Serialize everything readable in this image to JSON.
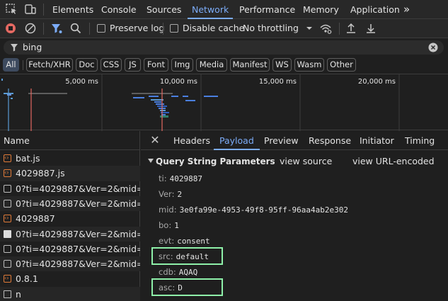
{
  "top_tabs": [
    {
      "label": "Elements"
    },
    {
      "label": "Console"
    },
    {
      "label": "Sources"
    },
    {
      "label": "Network"
    },
    {
      "label": "Performance"
    },
    {
      "label": "Memory"
    },
    {
      "label": "Application"
    }
  ],
  "more_tabs": "»",
  "toolbar": {
    "preserve_log": "Preserve log",
    "disable_cache": "Disable cache",
    "throttling": "No throttling"
  },
  "filter": {
    "value": "bing"
  },
  "chips": [
    {
      "label": "All"
    },
    {
      "label": "Fetch/XHR"
    },
    {
      "label": "Doc"
    },
    {
      "label": "CSS"
    },
    {
      "label": "JS"
    },
    {
      "label": "Font"
    },
    {
      "label": "Img"
    },
    {
      "label": "Media"
    },
    {
      "label": "Manifest"
    },
    {
      "label": "WS"
    },
    {
      "label": "Wasm"
    },
    {
      "label": "Other"
    }
  ],
  "overview": {
    "ticks": [
      "5,000 ms",
      "10,000 ms",
      "15,000 ms",
      "20,000 ms"
    ]
  },
  "namelist": {
    "header": "Name",
    "rows": [
      {
        "name": "bat.js",
        "icon": "js-file-icon"
      },
      {
        "name": "4029887.js",
        "icon": "js-file-icon"
      },
      {
        "name": "0?ti=4029887&Ver=2&mid=3...",
        "icon": "xhr-icon"
      },
      {
        "name": "0?ti=4029887&Ver=2&mid=3...",
        "icon": "xhr-icon"
      },
      {
        "name": "4029887",
        "icon": "js-file-icon"
      },
      {
        "name": "0?ti=4029887&Ver=2&mid=3...",
        "icon": "document-icon"
      },
      {
        "name": "0?ti=4029887&Ver=2&mid=3...",
        "icon": "xhr-icon"
      },
      {
        "name": "0?ti=4029887&Ver=2&mid=3...",
        "icon": "xhr-icon"
      },
      {
        "name": "0.8.1",
        "icon": "js-file-icon"
      },
      {
        "name": "n",
        "icon": "file-icon"
      }
    ]
  },
  "detail": {
    "tabs": [
      {
        "label": "Headers"
      },
      {
        "label": "Payload"
      },
      {
        "label": "Preview"
      },
      {
        "label": "Response"
      },
      {
        "label": "Initiator"
      },
      {
        "label": "Timing"
      }
    ],
    "section_title": "Query String Parameters",
    "view_source": "view source",
    "view_url_encoded": "view URL-encoded",
    "params": [
      {
        "key": "ti:",
        "value": "4029887"
      },
      {
        "key": "Ver:",
        "value": "2"
      },
      {
        "key": "mid:",
        "value": "3e0fa99e-4953-49f8-95ff-96aa4ab2e302"
      },
      {
        "key": "bo:",
        "value": "1"
      },
      {
        "key": "evt:",
        "value": "consent"
      },
      {
        "key": "src:",
        "value": "default"
      },
      {
        "key": "cdb:",
        "value": "AQAQ"
      },
      {
        "key": "asc:",
        "value": "D"
      }
    ]
  },
  "colors": {
    "accent": "#7cacf8",
    "highlight": "#8ef0a9",
    "record_red": "#e46962"
  }
}
